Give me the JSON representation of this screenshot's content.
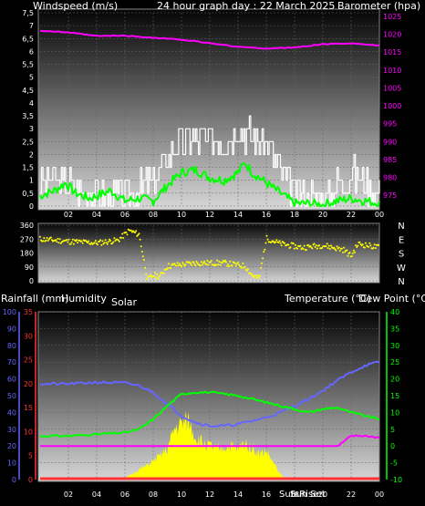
{
  "header": {
    "wind_label": "Windspeed (m/s)",
    "title": "24 hour graph day : 22 March 2025",
    "baro_label": "Barometer (hpa)"
  },
  "panel3_labels": {
    "rainfall": "Rainfall (mm)",
    "humidity": "Humidity",
    "solar": "Solar",
    "temperature": "Temperature (°C)",
    "dewpoint": "Dew Point (°C)"
  },
  "time_ticks": [
    "02",
    "04",
    "06",
    "08",
    "10",
    "12",
    "14",
    "16",
    "18",
    "20",
    "22",
    "00"
  ],
  "sun_labels": {
    "sunrise": "Sun Rise",
    "sunset": "Sun Set"
  },
  "colors": {
    "gust": "#ffffff",
    "wind_avg": "#00ff00",
    "barometer": "#ff00ff",
    "wind_dir": "#ffff00",
    "humidity": "#6666ff",
    "temperature": "#00ff00",
    "dewpoint": "#ff00ff",
    "solar": "#ffff00",
    "rain": "#ff3333"
  },
  "chart_data": [
    {
      "type": "line",
      "title": "24 hour graph day : 22 March 2025",
      "x_unit": "hour of day",
      "xlim": [
        0,
        24
      ],
      "left_axis": {
        "label": "Windspeed (m/s)",
        "lim": [
          0,
          7.5
        ],
        "ticks": [
          "0",
          "0,5",
          "1",
          "1,5",
          "2",
          "2,5",
          "3",
          "3,5",
          "4",
          "4,5",
          "5",
          "5,5",
          "6",
          "6,5",
          "7",
          "7,5"
        ]
      },
      "right_axis": {
        "label": "Barometer (hpa)",
        "lim": [
          972,
          1026
        ],
        "ticks": [
          "975",
          "980",
          "985",
          "990",
          "995",
          "1000",
          "1005",
          "1010",
          "1015",
          "1020",
          "1025"
        ]
      },
      "series": [
        {
          "axis": "left",
          "style": "jagged",
          "amp": 0.7,
          "seed": 3,
          "points": [
            [
              0,
              1.0
            ],
            [
              2,
              0.9
            ],
            [
              4,
              0.4
            ],
            [
              6,
              0.3
            ],
            [
              8,
              0.9
            ],
            [
              9,
              1.9
            ],
            [
              10,
              2.5
            ],
            [
              11,
              2.6
            ],
            [
              12,
              2.5
            ],
            [
              13,
              2.6
            ],
            [
              14,
              3.0
            ],
            [
              15,
              2.8
            ],
            [
              16,
              2.4
            ],
            [
              17,
              1.3
            ],
            [
              18,
              0.5
            ],
            [
              20,
              0.3
            ],
            [
              21,
              0.8
            ],
            [
              22,
              1.3
            ],
            [
              23,
              1.0
            ],
            [
              24,
              0.5
            ]
          ]
        },
        {
          "axis": "left",
          "style": "jagged",
          "amp": 0.18,
          "seed": 7,
          "points": [
            [
              0,
              0.4
            ],
            [
              1,
              0.6
            ],
            [
              1.8,
              0.9
            ],
            [
              2.5,
              0.5
            ],
            [
              3.5,
              0.3
            ],
            [
              4,
              0.4
            ],
            [
              5,
              0.6
            ],
            [
              6,
              0.2
            ],
            [
              7,
              0.3
            ],
            [
              8,
              0.2
            ],
            [
              9,
              0.8
            ],
            [
              10,
              1.3
            ],
            [
              11,
              1.4
            ],
            [
              12,
              1.1
            ],
            [
              13,
              1.0
            ],
            [
              14,
              1.3
            ],
            [
              14.5,
              1.7
            ],
            [
              15,
              1.3
            ],
            [
              16,
              0.9
            ],
            [
              17,
              0.5
            ],
            [
              18,
              0.1
            ],
            [
              19,
              0.1
            ],
            [
              20,
              0.05
            ],
            [
              21,
              0.2
            ],
            [
              22,
              0.3
            ],
            [
              23,
              0.2
            ],
            [
              24,
              0.1
            ]
          ]
        },
        {
          "axis": "right",
          "style": "smooth",
          "points": [
            [
              0,
              1021
            ],
            [
              2,
              1020.5
            ],
            [
              4,
              1019.5
            ],
            [
              6,
              1019.6
            ],
            [
              8,
              1019
            ],
            [
              10,
              1018.5
            ],
            [
              12,
              1017.5
            ],
            [
              14,
              1016.5
            ],
            [
              16,
              1016
            ],
            [
              18,
              1016.3
            ],
            [
              20,
              1017.2
            ],
            [
              22,
              1017.5
            ],
            [
              24,
              1016.8
            ]
          ]
        }
      ]
    },
    {
      "type": "scatter",
      "y_unit": "degrees",
      "xlim": [
        0,
        24
      ],
      "ylim": [
        0,
        360
      ],
      "ticks": [
        "0",
        "90",
        "180",
        "270",
        "360"
      ],
      "compass_labels": [
        "N",
        "W",
        "S",
        "E",
        "N"
      ],
      "series": [
        {
          "name": "wind direction",
          "seed": 11,
          "spread": 18,
          "points": [
            [
              0,
              270
            ],
            [
              2,
              255
            ],
            [
              4,
              245
            ],
            [
              5.5,
              262
            ],
            [
              6.3,
              325
            ],
            [
              7,
              300
            ],
            [
              7.6,
              5
            ],
            [
              8,
              35
            ],
            [
              8.5,
              30
            ],
            [
              9,
              95
            ],
            [
              11,
              115
            ],
            [
              13,
              115
            ],
            [
              14.5,
              95
            ],
            [
              15,
              35
            ],
            [
              15.5,
              15
            ],
            [
              16,
              275
            ],
            [
              17,
              240
            ],
            [
              18.5,
              215
            ],
            [
              20,
              230
            ],
            [
              21.5,
              200
            ],
            [
              22,
              160
            ],
            [
              22.5,
              240
            ],
            [
              24,
              215
            ]
          ]
        }
      ]
    },
    {
      "type": "line",
      "xlim": [
        0,
        24
      ],
      "axes": [
        {
          "label": "Humidity",
          "lim": [
            0,
            100
          ],
          "ticks": [
            "0",
            "10",
            "20",
            "30",
            "40",
            "50",
            "60",
            "70",
            "80",
            "90",
            "100"
          ]
        },
        {
          "label": "Rainfall (mm)",
          "lim": [
            0,
            35
          ],
          "ticks": [
            "0",
            "5",
            "10",
            "15",
            "20",
            "25",
            "30",
            "35"
          ]
        },
        {
          "label": "Temperature (°C)",
          "lim": [
            -10,
            40
          ],
          "ticks": [
            "-10",
            "-5",
            "0",
            "5",
            "10",
            "15",
            "20",
            "25",
            "30",
            "35",
            "40"
          ]
        }
      ],
      "series": [
        {
          "axis": 0,
          "seed": 21,
          "amp": 0.8,
          "points": [
            [
              0,
              57
            ],
            [
              2,
              57
            ],
            [
              4,
              58
            ],
            [
              6,
              57.5
            ],
            [
              7,
              56
            ],
            [
              8,
              52
            ],
            [
              9,
              45
            ],
            [
              10,
              38
            ],
            [
              11,
              34
            ],
            [
              12,
              32
            ],
            [
              13,
              32
            ],
            [
              14,
              33
            ],
            [
              15,
              35
            ],
            [
              16,
              37
            ],
            [
              17,
              40
            ],
            [
              18,
              44
            ],
            [
              19,
              48
            ],
            [
              20,
              53
            ],
            [
              21,
              59
            ],
            [
              22,
              64
            ],
            [
              23,
              68
            ],
            [
              24,
              70
            ]
          ]
        },
        {
          "axis": 2,
          "seed": 31,
          "amp": 0.3,
          "points": [
            [
              0,
              3
            ],
            [
              2,
              3
            ],
            [
              4,
              3.5
            ],
            [
              6,
              4
            ],
            [
              7,
              5
            ],
            [
              8,
              8
            ],
            [
              9,
              12
            ],
            [
              10,
              15.5
            ],
            [
              11,
              16
            ],
            [
              12,
              16
            ],
            [
              13,
              15.5
            ],
            [
              14,
              15
            ],
            [
              15,
              14
            ],
            [
              16,
              13
            ],
            [
              17,
              12
            ],
            [
              18,
              11
            ],
            [
              19,
              10
            ],
            [
              20,
              11
            ],
            [
              21,
              11.5
            ],
            [
              22,
              10
            ],
            [
              23,
              9
            ],
            [
              24,
              8
            ]
          ]
        },
        {
          "axis": 2,
          "seed": 41,
          "amp": 0.25,
          "points": [
            [
              0,
              -5
            ],
            [
              2,
              -4.5
            ],
            [
              4,
              -4.5
            ],
            [
              6,
              -4
            ],
            [
              8,
              -3
            ],
            [
              10,
              -2
            ],
            [
              12,
              -1
            ],
            [
              14,
              -0.5
            ],
            [
              16,
              -0.5
            ],
            [
              18,
              -0.3
            ],
            [
              20,
              -0.3
            ],
            [
              21,
              -0.3
            ],
            [
              22,
              3
            ],
            [
              23,
              3
            ],
            [
              24,
              2.5
            ]
          ]
        },
        {
          "axis": 0,
          "style": "area",
          "seed": 51,
          "points": [
            [
              5.7,
              0
            ],
            [
              6,
              1
            ],
            [
              6.5,
              3
            ],
            [
              7,
              6
            ],
            [
              7.5,
              8
            ],
            [
              8,
              11
            ],
            [
              8.5,
              14
            ],
            [
              9,
              18
            ],
            [
              9.5,
              30
            ],
            [
              10,
              33
            ],
            [
              10.5,
              35
            ],
            [
              11,
              25
            ],
            [
              11.5,
              22
            ],
            [
              12,
              20
            ],
            [
              12.5,
              18
            ],
            [
              13,
              19
            ],
            [
              13.5,
              20
            ],
            [
              14,
              18
            ],
            [
              14.5,
              22
            ],
            [
              15,
              19
            ],
            [
              15.5,
              15
            ],
            [
              16,
              17
            ],
            [
              16.5,
              10
            ],
            [
              17,
              3
            ],
            [
              17.4,
              0
            ]
          ]
        },
        {
          "axis": 1,
          "style": "baseline",
          "points": [
            [
              0,
              0
            ],
            [
              24,
              0
            ]
          ]
        }
      ]
    }
  ]
}
